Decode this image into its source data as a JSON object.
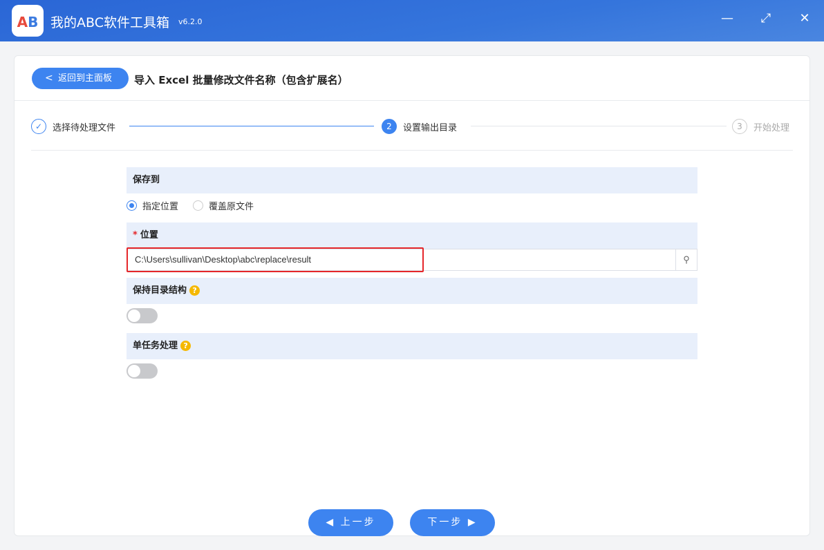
{
  "app": {
    "title": "我的ABC软件工具箱",
    "version": "v6.2.0",
    "logo_text": "AB"
  },
  "window": {
    "minimize": "—",
    "maximize": "⤢",
    "close": "✕"
  },
  "header": {
    "back_label": "返回到主面板",
    "page_title": "导入 Excel 批量修改文件名称（包含扩展名）"
  },
  "steps": [
    {
      "num": "✓",
      "label": "选择待处理文件"
    },
    {
      "num": "2",
      "label": "设置输出目录"
    },
    {
      "num": "3",
      "label": "开始处理"
    }
  ],
  "save_to": {
    "title": "保存到",
    "options": [
      "指定位置",
      "覆盖原文件"
    ],
    "selected": 0
  },
  "location": {
    "required": "*",
    "title": "位置",
    "value": "C:\\Users\\sullivan\\Desktop\\abc\\replace\\result"
  },
  "keep_structure": {
    "title": "保持目录结构",
    "help": "?",
    "on": false
  },
  "single_task": {
    "title": "单任务处理",
    "help": "?",
    "on": false
  },
  "footer": {
    "prev": "上一步",
    "next": "下一步"
  }
}
